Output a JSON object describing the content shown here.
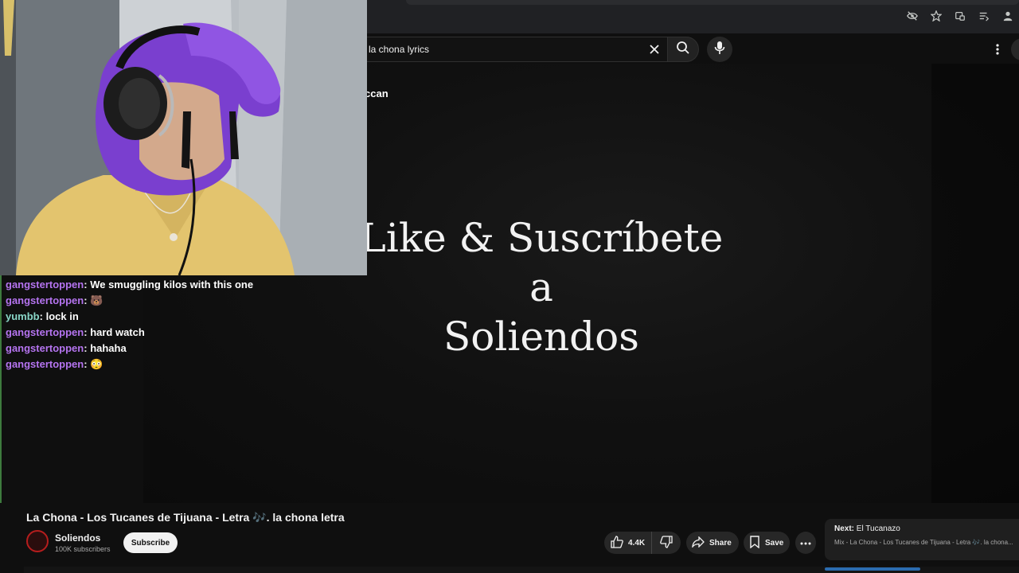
{
  "search": {
    "query": "la chona lyrics"
  },
  "video": {
    "title_fragment": "ccan",
    "overlay_lines": [
      "Like & Suscríbete a",
      "Soliendos"
    ]
  },
  "chat": [
    {
      "user": "gangstertoppen",
      "message": "We smuggling kilos with this one",
      "emoji": ""
    },
    {
      "user": "gangstertoppen",
      "message": "",
      "emoji": "🐻"
    },
    {
      "user": "yumbb",
      "message": "lock in",
      "emoji": ""
    },
    {
      "user": "gangstertoppen",
      "message": "hard watch",
      "emoji": ""
    },
    {
      "user": "gangstertoppen",
      "message": "hahaha",
      "emoji": ""
    },
    {
      "user": "gangstertoppen",
      "message": "",
      "emoji": "😳"
    }
  ],
  "watch": {
    "title": "La Chona - Los Tucanes de Tijuana - Letra 🎶. la chona letra",
    "channel_name": "Soliendos",
    "subscribers": "100K subscribers",
    "subscribe_label": "Subscribe",
    "like_count": "4.4K",
    "share_label": "Share",
    "save_label": "Save"
  },
  "next": {
    "prefix": "Next:",
    "title": "El Tucanazo",
    "subtitle": "Mix - La Chona - Los Tucanes de Tijuana - Letra 🎶. la chona..."
  },
  "colors": {
    "chat_user": "#b574f0",
    "chat_user_alt": "#8ad7c8",
    "channel_ring": "#b51d1d",
    "hoodie": "#7a3fcf",
    "shirt": "#e6c66f"
  },
  "icons": [
    "eye-off-icon",
    "star-icon",
    "extensions-icon",
    "reading-list-icon",
    "profile-icon",
    "close-icon",
    "search-icon",
    "mic-icon",
    "kebab-icon",
    "thumbs-up-icon",
    "thumbs-down-icon",
    "share-icon",
    "bookmark-icon",
    "more-icon"
  ]
}
